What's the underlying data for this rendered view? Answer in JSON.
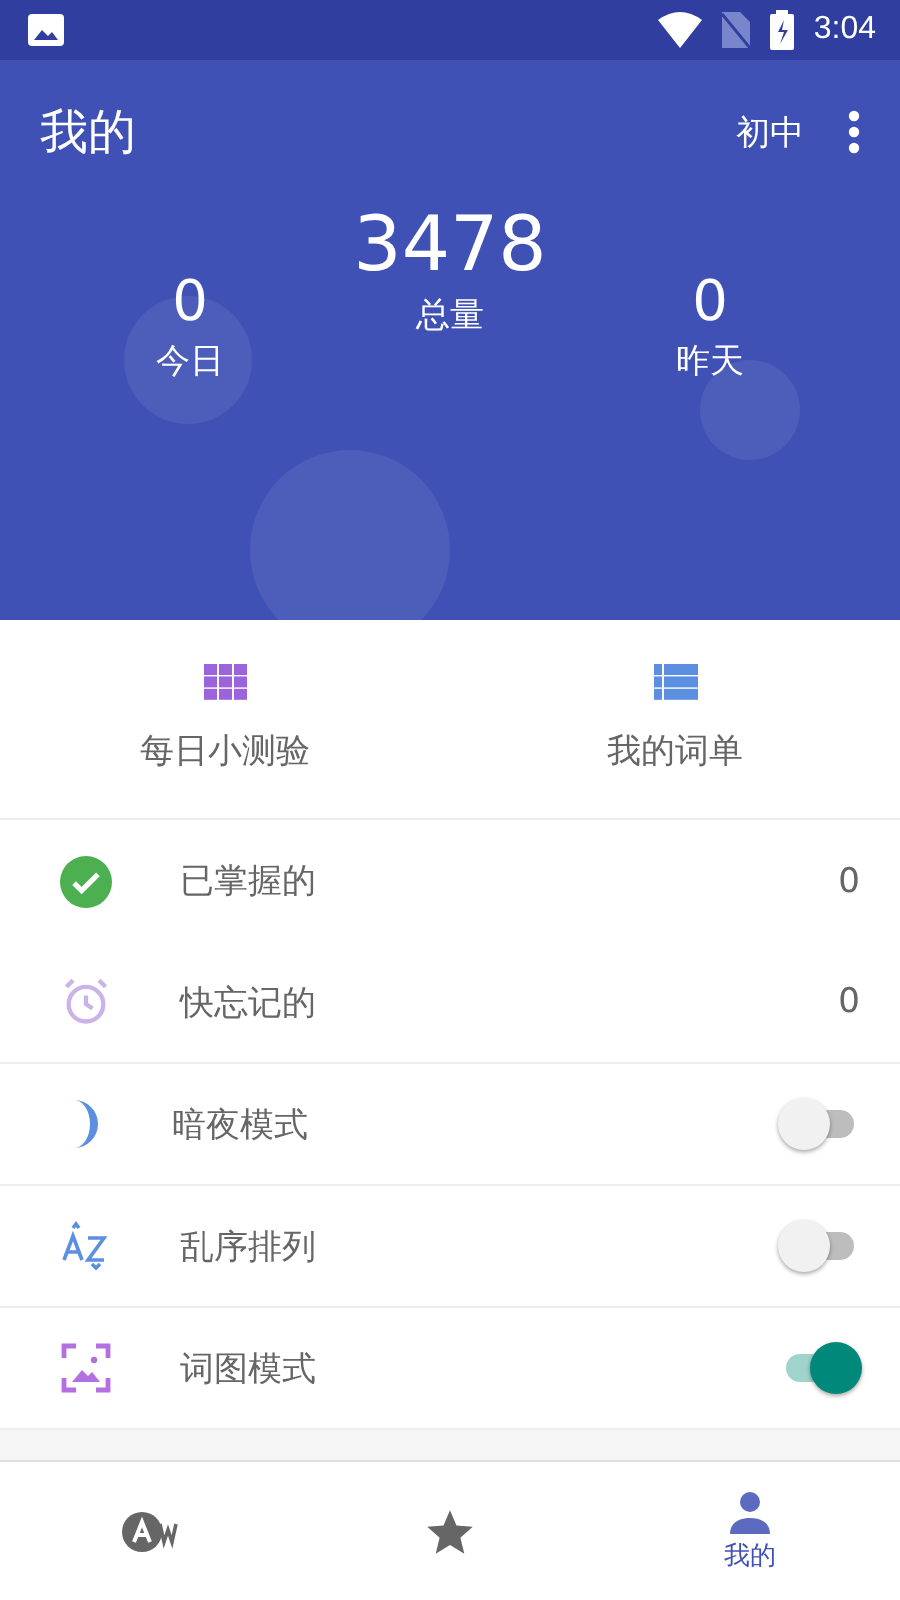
{
  "status_bar": {
    "time": "3:04"
  },
  "header": {
    "title": "我的",
    "level_label": "初中"
  },
  "stats": {
    "total": {
      "value": "3478",
      "label": "总量"
    },
    "today": {
      "value": "0",
      "label": "今日"
    },
    "yesterday": {
      "value": "0",
      "label": "昨天"
    }
  },
  "actions": [
    {
      "kind": "grid",
      "label": "每日小测验"
    },
    {
      "kind": "list",
      "label": "我的词单"
    }
  ],
  "rows": [
    {
      "kind": "count",
      "label": "已掌握的",
      "value": "0"
    },
    {
      "kind": "count",
      "label": "快忘记的",
      "value": "0"
    },
    {
      "kind": "toggle",
      "label": "暗夜模式",
      "on": false
    },
    {
      "kind": "toggle",
      "label": "乱序排列",
      "on": false
    },
    {
      "kind": "toggle",
      "label": "词图模式",
      "on": true
    }
  ],
  "bottom_nav": [
    {
      "selected": false
    },
    {
      "selected": false
    },
    {
      "label": "我的",
      "selected": true
    }
  ]
}
